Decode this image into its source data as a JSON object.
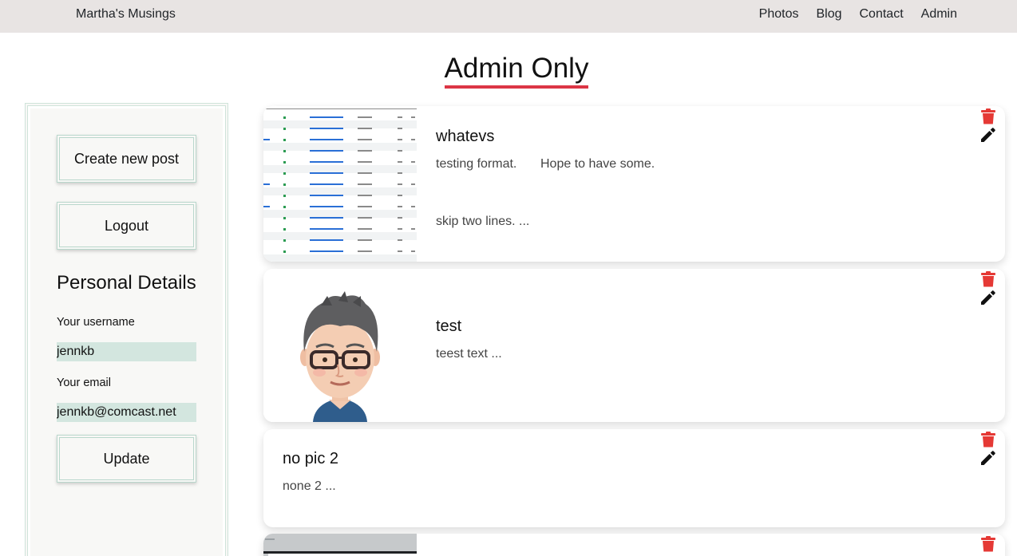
{
  "navbar": {
    "brand": "Martha's Musings",
    "links": [
      "Photos",
      "Blog",
      "Contact",
      "Admin"
    ]
  },
  "page": {
    "title": "Admin Only"
  },
  "sidebar": {
    "create_label": "Create new post",
    "logout_label": "Logout",
    "heading": "Personal Details",
    "username_label": "Your username",
    "username_value": "jennkb",
    "email_label": "Your email",
    "email_value": "jennkb@comcast.net",
    "update_label": "Update"
  },
  "posts": [
    {
      "title": "whatevs",
      "text_a": "testing format.",
      "text_b": "Hope to have some.",
      "text_c": "skip two lines. ...",
      "thumbnail": "spreadsheet screenshot"
    },
    {
      "title": "test",
      "text_a": "teest text ...",
      "thumbnail": "cartoon avatar"
    },
    {
      "title": "no pic 2",
      "text_a": "none 2 ..."
    },
    {
      "title": "",
      "thumbnail": "gray image"
    }
  ],
  "icons": {
    "delete": "trash-icon",
    "edit": "pencil-icon"
  },
  "colors": {
    "navbar_bg": "#e8e4e3",
    "title_underline": "#dc3545",
    "trash": "#e53935",
    "sidebar_border": "#cfe3da",
    "input_bg": "#d3e6df"
  }
}
